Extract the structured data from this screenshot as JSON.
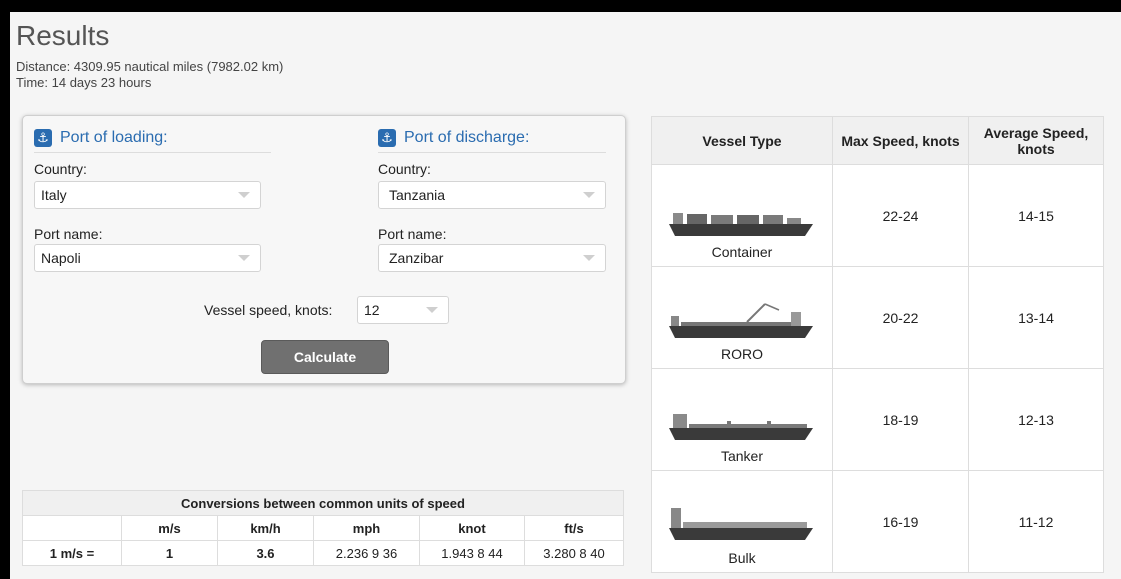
{
  "results": {
    "title": "Results",
    "distance": "Distance: 4309.95 nautical miles (7982.02 km)",
    "time": "Time: 14 days 23 hours"
  },
  "loading": {
    "title": "Port of loading:",
    "country_label": "Country:",
    "country_value": "Italy",
    "port_label": "Port name:",
    "port_value": "Napoli"
  },
  "discharge": {
    "title": "Port of discharge:",
    "country_label": "Country:",
    "country_value": "Tanzania",
    "port_label": "Port name:",
    "port_value": "Zanzibar"
  },
  "speed": {
    "label": "Vessel speed, knots:",
    "value": "12"
  },
  "calculate_label": "Calculate",
  "conversions": {
    "caption": "Conversions between common units of speed",
    "headers": [
      "",
      "m/s",
      "km/h",
      "mph",
      "knot",
      "ft/s"
    ],
    "row": [
      "1 m/s =",
      "1",
      "3.6",
      "2.236 9 36",
      "1.943 8 44",
      "3.280 8 40"
    ]
  },
  "vessel_table": {
    "headers": [
      "Vessel Type",
      "Max Speed, knots",
      "Average Speed, knots"
    ],
    "rows": [
      {
        "name": "Container",
        "max": "22-24",
        "avg": "14-15"
      },
      {
        "name": "RORO",
        "max": "20-22",
        "avg": "13-14"
      },
      {
        "name": "Tanker",
        "max": "18-19",
        "avg": "12-13"
      },
      {
        "name": "Bulk",
        "max": "16-19",
        "avg": "11-12"
      }
    ]
  },
  "colors": {
    "accent": "#2a6cb0",
    "button": "#707070"
  },
  "icons": [
    "anchor-icon",
    "chevron-down-icon"
  ]
}
